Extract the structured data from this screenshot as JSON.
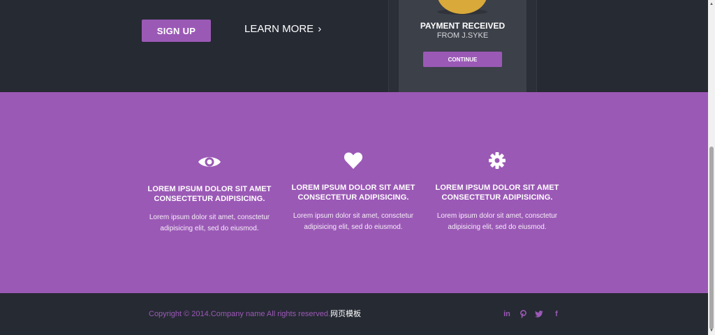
{
  "hero": {
    "signup_label": "SIGN UP",
    "learn_more_label": "LEARN MORE",
    "learn_more_chevron": "›"
  },
  "phone": {
    "payment_title": "PAYMENT RECEIVED",
    "payment_from": "FROM J.SYKE",
    "continue_label": "CONTINUE"
  },
  "features": [
    {
      "icon": "eye-icon",
      "heading_line1": "LOREM IPSUM DOLOR SIT AMET",
      "heading_line2": "CONSECTETUR ADIPISICING.",
      "body_line1": "Lorem ipsum dolor sit amet, consctetur",
      "body_line2": "adipisicing elit, sed do eiusmod."
    },
    {
      "icon": "heart-icon",
      "heading_line1": "LOREM IPSUM DOLOR SIT AMET",
      "heading_line2": "CONSECTETUR ADIPISICING.",
      "body_line1": "Lorem ipsum dolor sit amet, consctetur",
      "body_line2": "adipisicing elit, sed do eiusmod."
    },
    {
      "icon": "gear-icon",
      "heading_line1": "LOREM IPSUM DOLOR SIT AMET",
      "heading_line2": "CONSECTETUR ADIPISICING.",
      "body_line1": "Lorem ipsum dolor sit amet, consctetur",
      "body_line2": "adipisicing elit, sed do eiusmod."
    }
  ],
  "footer": {
    "copyright": "Copyright © 2014.Company name All rights reserved.",
    "copyright_cn": "网页模板",
    "social": [
      {
        "icon": "linkedin-icon",
        "glyph": "in"
      },
      {
        "icon": "pinterest-icon",
        "glyph": "P"
      },
      {
        "icon": "twitter-icon",
        "glyph": "t"
      },
      {
        "icon": "facebook-icon",
        "glyph": "f"
      }
    ]
  },
  "colors": {
    "accent": "#9b59b6",
    "dark": "#262a33",
    "coin": "#d9a93a"
  }
}
